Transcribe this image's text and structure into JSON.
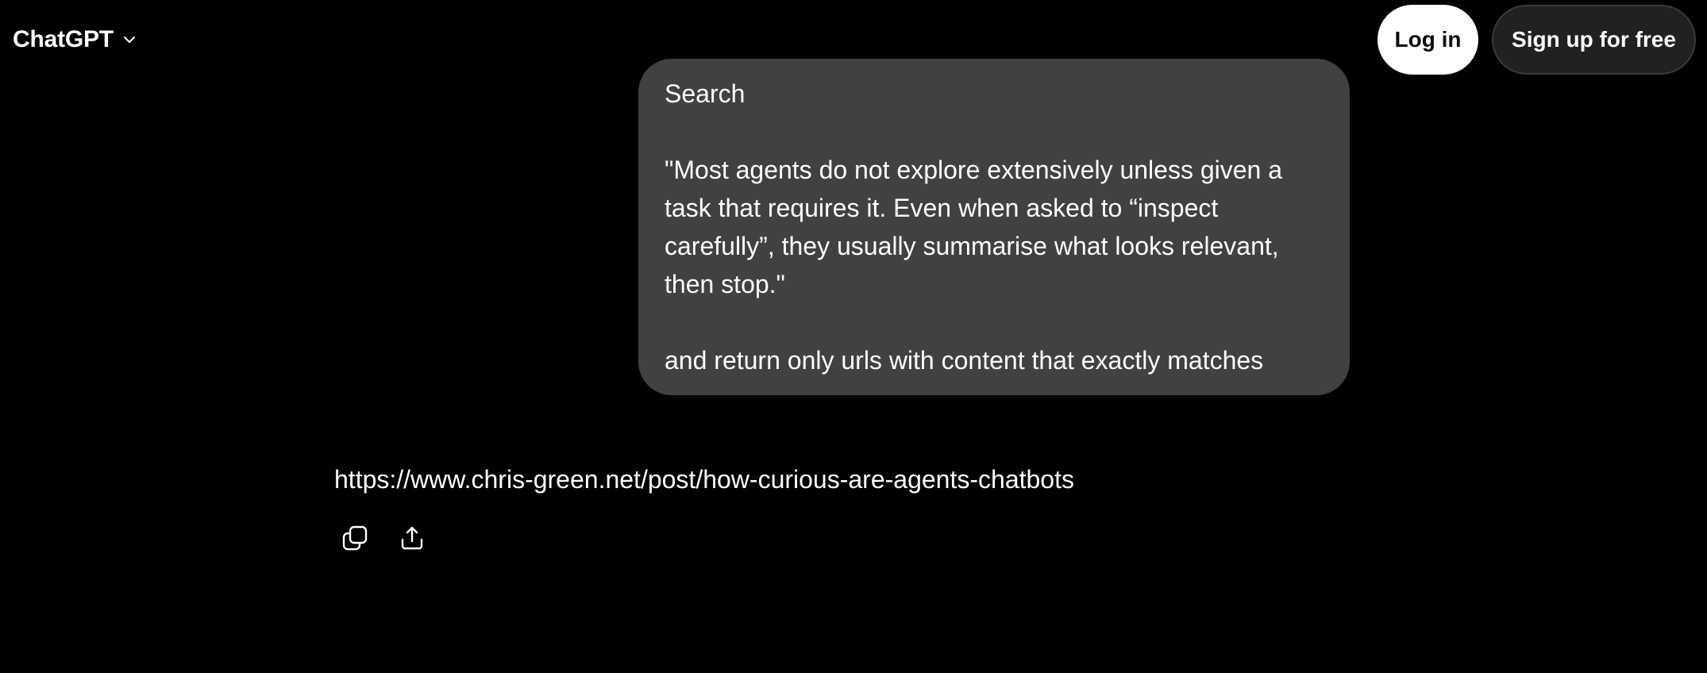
{
  "header": {
    "brand_title": "ChatGPT",
    "brand_menu_icon": "chevron-down-icon",
    "login_label": "Log in",
    "signup_label": "Sign up for free"
  },
  "conversation": {
    "user_message": {
      "line1": "Search",
      "line2": "\"Most agents do not explore extensively unless given a",
      "line3": "task that requires it. Even when asked to “inspect",
      "line4": "carefully”, they usually summarise what looks relevant,",
      "line5": "then stop.\"",
      "line6": "and return only urls with content that exactly matches"
    },
    "assistant_reply": {
      "text": "https://www.chris-green.net/post/how-curious-are-agents-chatbots",
      "actions": [
        {
          "icon": "copy-icon"
        },
        {
          "icon": "share-icon"
        }
      ]
    }
  },
  "colors": {
    "background": "#000000",
    "bubble": "#414141",
    "login_bg": "#ffffff",
    "signup_bg": "#212121",
    "text": "#ffffff"
  }
}
